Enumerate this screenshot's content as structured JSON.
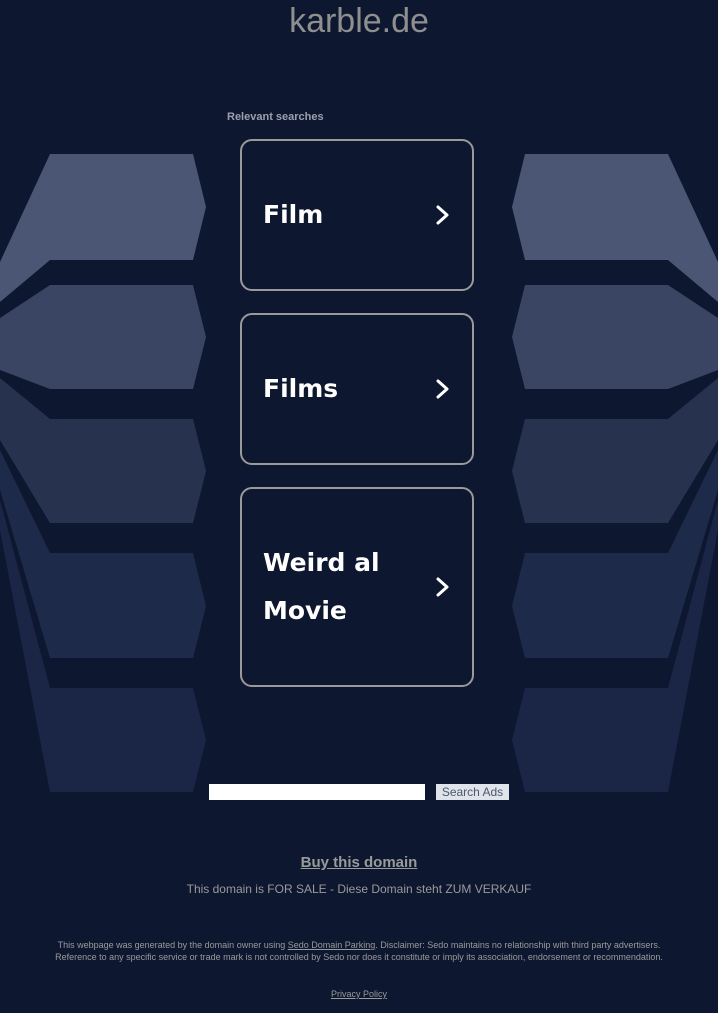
{
  "domain": "karble.de",
  "relevant_searches_label": "Relevant searches",
  "cards": [
    {
      "label_lines": [
        "Film"
      ]
    },
    {
      "label_lines": [
        "Films"
      ]
    },
    {
      "label_lines": [
        "Weird al",
        "Movie"
      ]
    }
  ],
  "search": {
    "button_label": "Search Ads",
    "value": "",
    "placeholder": ""
  },
  "buy_domain_label": "Buy this domain",
  "for_sale_text": "This domain is FOR SALE - Diese Domain steht ZUM VERKAUF",
  "disclaimer": {
    "before_link": "This webpage was generated by the domain owner using ",
    "link_text": "Sedo Domain Parking",
    "after_link": ". Disclaimer: Sedo maintains no relationship with third party advertisers. Reference to any specific service or trade mark is not controlled by Sedo nor does it constitute or imply its association, endorsement or recommendation."
  },
  "privacy_policy_label": "Privacy Policy",
  "colors": {
    "background": "#0e1730",
    "card_border": "#9a9a9a",
    "card_text": "#ffffff",
    "muted_text": "#9a9a9a",
    "band_1": "#4b5675",
    "band_2": "#3a4563",
    "band_3": "#27324f",
    "band_4": "#1e2a49",
    "band_5": "#1b2647"
  },
  "icons": {
    "card_arrow": "chevron-right-icon"
  }
}
